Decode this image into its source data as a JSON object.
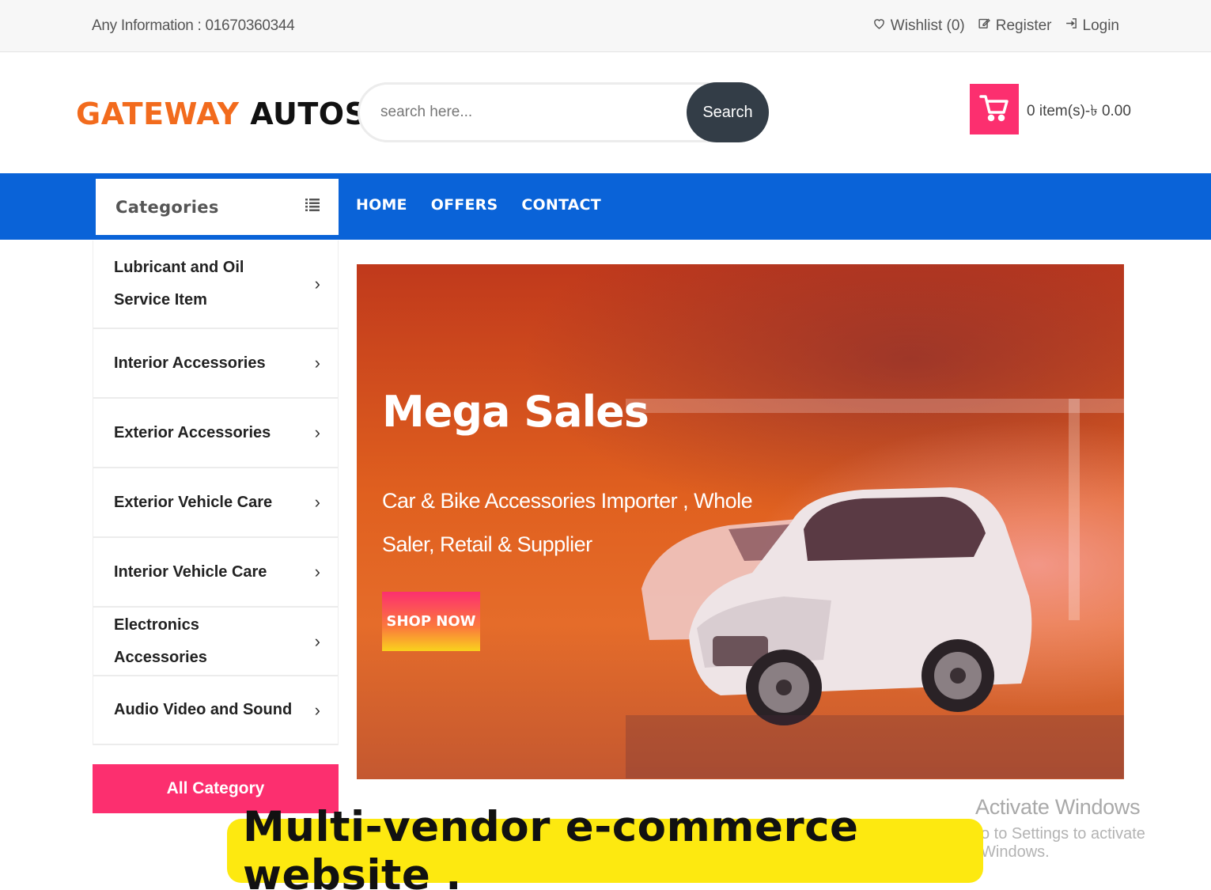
{
  "topbar": {
    "info": "Any Information : 01670360344",
    "wishlist": "Wishlist (0)",
    "register": "Register",
    "login": "Login"
  },
  "header": {
    "logo_part1": "GATEWAY",
    "logo_part2": "AUTOS",
    "search_placeholder": "search here...",
    "search_button": "Search",
    "cart_text": "0 item(s)-৳ 0.00"
  },
  "nav": {
    "categories_label": "Categories",
    "menu": [
      "HOME",
      "OFFERS",
      "CONTACT"
    ]
  },
  "categories": [
    "Lubricant and Oil Service Item",
    "Interior Accessories",
    "Exterior Accessories",
    "Exterior Vehicle Care",
    "Interior Vehicle Care",
    "Electronics Accessories",
    "Audio Video and Sound"
  ],
  "all_category_button": "All Category",
  "banner": {
    "title": "Mega Sales",
    "subtitle": "Car & Bike Accessories Importer , Whole Saler, Retail & Supplier",
    "button": "SHOP NOW"
  },
  "watermark": {
    "line1": "Activate Windows",
    "line2": "o to Settings to activate Windows."
  },
  "caption": "Multi-vendor e-commerce website .",
  "colors": {
    "brand_orange": "#f26b1d",
    "nav_blue": "#0a63d8",
    "accent_pink": "#fc2f6f",
    "search_button": "#333d47",
    "caption_yellow": "#fde910"
  }
}
